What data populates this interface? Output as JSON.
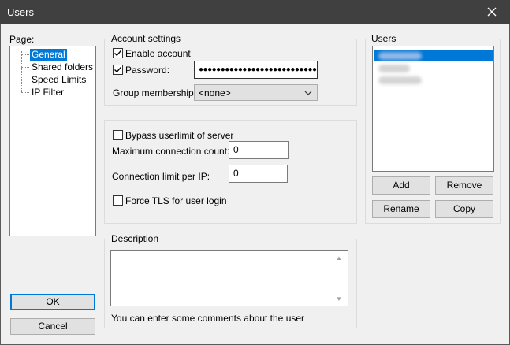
{
  "window": {
    "title": "Users"
  },
  "page_panel": {
    "label": "Page:",
    "items": [
      {
        "label": "General",
        "selected": true
      },
      {
        "label": "Shared folders",
        "selected": false
      },
      {
        "label": "Speed Limits",
        "selected": false
      },
      {
        "label": "IP Filter",
        "selected": false
      }
    ]
  },
  "account": {
    "group_title": "Account settings",
    "enable_account_label": "Enable account",
    "enable_account_checked": true,
    "password_label": "Password:",
    "password_checked": true,
    "password_value": "●●●●●●●●●●●●●●●●●●●●●●●●●●●●●●●",
    "group_membership_label": "Group membership:",
    "group_membership_value": "<none>"
  },
  "limits": {
    "bypass_label": "Bypass userlimit of server",
    "bypass_checked": false,
    "max_conn_label": "Maximum connection count:",
    "max_conn_value": "0",
    "conn_per_ip_label": "Connection limit per IP:",
    "conn_per_ip_value": "0",
    "force_tls_label": "Force TLS for user login",
    "force_tls_checked": false
  },
  "description": {
    "group_title": "Description",
    "value": "",
    "hint": "You can enter some comments about the user"
  },
  "users": {
    "group_title": "Users",
    "add_label": "Add",
    "remove_label": "Remove",
    "rename_label": "Rename",
    "copy_label": "Copy"
  },
  "buttons": {
    "ok_label": "OK",
    "cancel_label": "Cancel"
  },
  "icons": {
    "close": "close-icon",
    "check": "checkmark-icon",
    "dropdown": "chevron-down-icon",
    "scroll_up": "scroll-up-arrow-icon",
    "scroll_down": "scroll-down-arrow-icon"
  },
  "colors": {
    "titlebar": "#404040",
    "selection": "#0078d7",
    "dialog_bg": "#f0f0f0"
  }
}
